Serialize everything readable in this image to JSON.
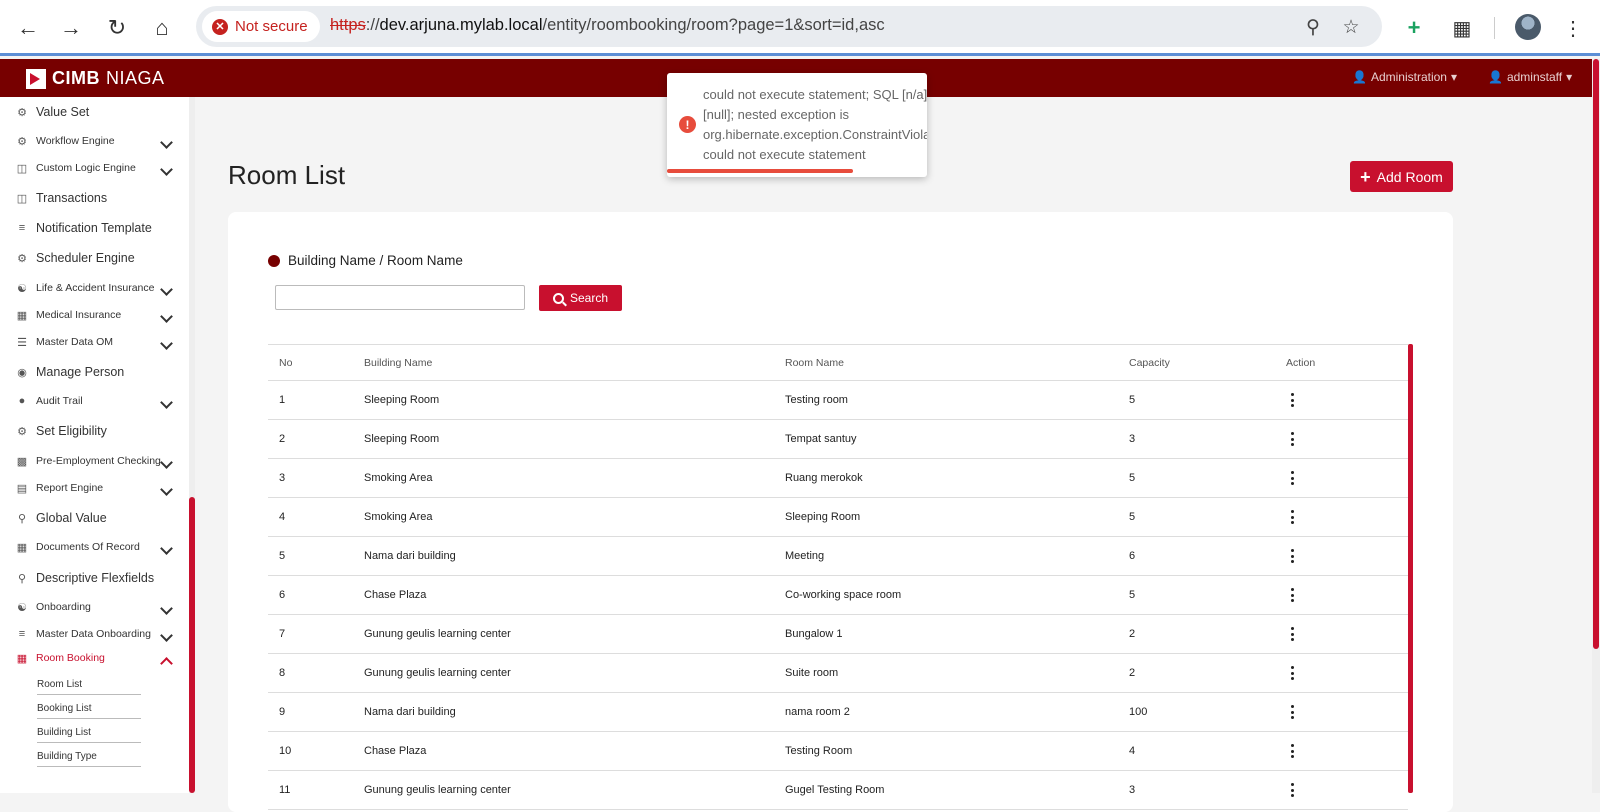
{
  "browser": {
    "security_label": "Not secure",
    "url_protocol": "https",
    "url_sep": "://",
    "url_host": "dev.arjuna.mylab.local",
    "url_path": "/entity/roombooking/room?page=1&sort=id,asc"
  },
  "app": {
    "logo_bold": "CIMB",
    "logo_thin": "NIAGA",
    "admin_menu": "Administration",
    "user_menu": "adminstaff"
  },
  "sidebar": {
    "items": [
      {
        "label": "Value Set",
        "icon": "gear-icon"
      },
      {
        "label": "Workflow Engine",
        "icon": "gear-icon"
      },
      {
        "label": "Custom Logic Engine",
        "icon": "database-icon"
      },
      {
        "label": "Transactions",
        "icon": "database-icon"
      },
      {
        "label": "Notification Template",
        "icon": "list-icon"
      },
      {
        "label": "Scheduler Engine",
        "icon": "gear-icon"
      },
      {
        "label": "Life & Accident Insurance",
        "icon": "people-icon"
      },
      {
        "label": "Medical Insurance",
        "icon": "table-icon"
      },
      {
        "label": "Master Data OM",
        "icon": "menu-icon"
      },
      {
        "label": "Manage Person",
        "icon": "user-circle-icon"
      },
      {
        "label": "Audit Trail",
        "icon": "user-icon"
      },
      {
        "label": "Set Eligibility",
        "icon": "gear-icon"
      },
      {
        "label": "Pre-Employment Checking",
        "icon": "calendar-icon"
      },
      {
        "label": "Report Engine",
        "icon": "report-icon"
      },
      {
        "label": "Global Value",
        "icon": "search-icon"
      },
      {
        "label": "Documents Of Record",
        "icon": "table-icon"
      },
      {
        "label": "Descriptive Flexfields",
        "icon": "search-icon"
      },
      {
        "label": "Onboarding",
        "icon": "people-icon"
      },
      {
        "label": "Master Data Onboarding",
        "icon": "list-icon"
      },
      {
        "label": "Room Booking",
        "icon": "table-icon"
      }
    ],
    "sub_items": [
      "Room List",
      "Booking List",
      "Building List",
      "Building Type"
    ]
  },
  "main": {
    "title": "Room List",
    "add_button": "Add Room",
    "filter_label": "Building Name / Room Name",
    "search_value": "",
    "search_button": "Search"
  },
  "table": {
    "headers": [
      "No",
      "Building Name",
      "Room Name",
      "Capacity",
      "Action"
    ],
    "rows": [
      [
        "1",
        "Sleeping Room",
        "Testing room",
        "5"
      ],
      [
        "2",
        "Sleeping Room",
        "Tempat santuy",
        "3"
      ],
      [
        "3",
        "Smoking Area",
        "Ruang merokok",
        "5"
      ],
      [
        "4",
        "Smoking Area",
        "Sleeping Room",
        "5"
      ],
      [
        "5",
        "Nama dari building",
        "Meeting",
        "6"
      ],
      [
        "6",
        "Chase Plaza",
        "Co-working space room",
        "5"
      ],
      [
        "7",
        "Gunung geulis learning center",
        "Bungalow 1",
        "2"
      ],
      [
        "8",
        "Gunung geulis learning center",
        "Suite room",
        "2"
      ],
      [
        "9",
        "Nama dari building",
        "nama room 2",
        "100"
      ],
      [
        "10",
        "Chase Plaza",
        "Testing Room",
        "4"
      ],
      [
        "11",
        "Gunung geulis learning center",
        "Gugel Testing Room",
        "3"
      ]
    ]
  },
  "toast": {
    "message": "could not execute statement; SQL [n/a]\n[null]; nested exception is\norg.hibernate.exception.ConstraintViolationException:\ncould not execute statement",
    "progress": 0.73
  },
  "colors": {
    "brand_dark": "#770000",
    "brand_red": "#c8102e",
    "error": "#e74c3c"
  }
}
